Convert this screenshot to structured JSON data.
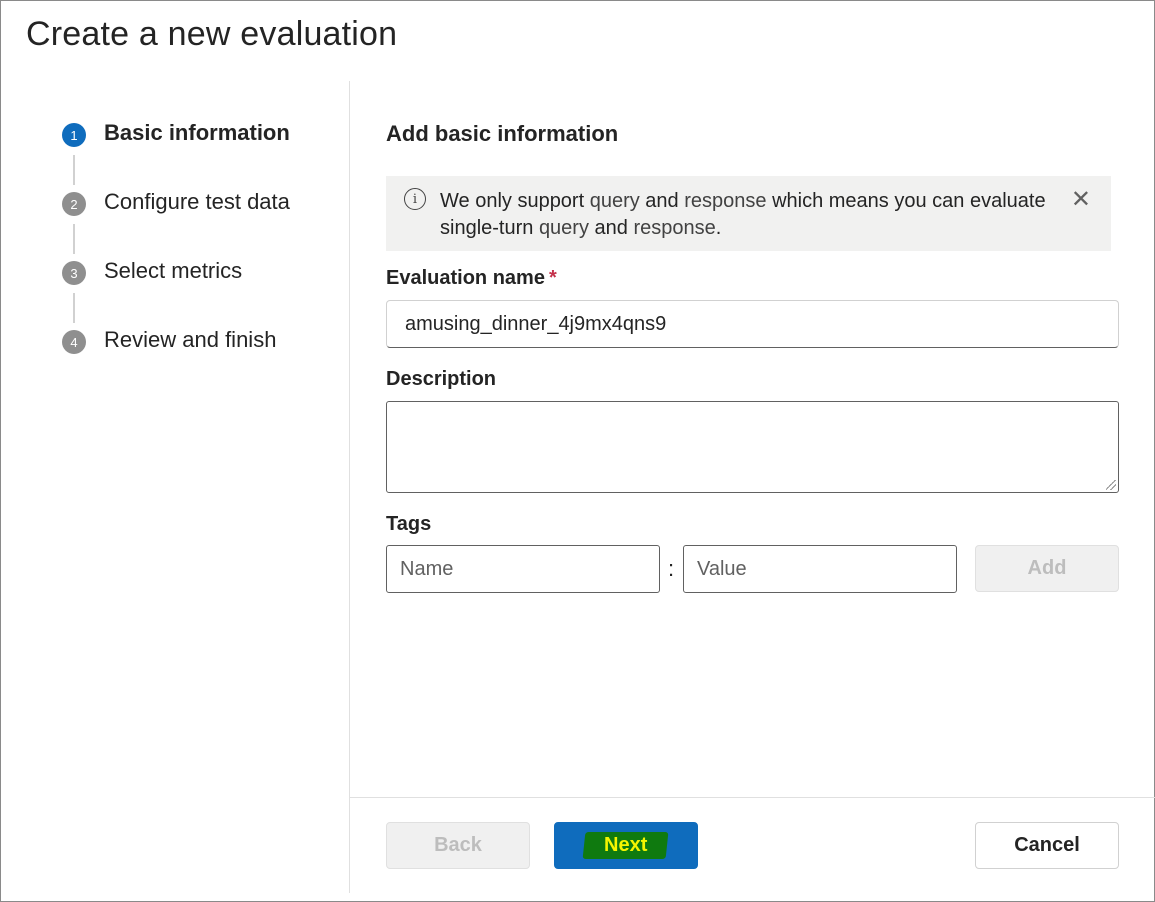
{
  "dialog": {
    "title": "Create a new evaluation"
  },
  "stepper": {
    "steps": [
      {
        "number": "1",
        "label": "Basic information",
        "active": true
      },
      {
        "number": "2",
        "label": "Configure test data",
        "active": false
      },
      {
        "number": "3",
        "label": "Select metrics",
        "active": false
      },
      {
        "number": "4",
        "label": "Review and finish",
        "active": false
      }
    ]
  },
  "form": {
    "section_title": "Add basic information",
    "info_bar": {
      "icon": "info-icon",
      "text_part1": "We only support ",
      "kw1": "query",
      "text_part2": " and ",
      "kw2": "response",
      "text_part3": " which means you can evaluate single-turn ",
      "kw3": "query",
      "text_part4": " and ",
      "kw4": "response",
      "text_part5": ".",
      "close_glyph": "✕"
    },
    "evaluation_name": {
      "label": "Evaluation name",
      "required_mark": "*",
      "value": "amusing_dinner_4j9mx4qns9"
    },
    "description": {
      "label": "Description",
      "value": ""
    },
    "tags": {
      "label": "Tags",
      "name_placeholder": "Name",
      "separator": ":",
      "value_placeholder": "Value",
      "add_label": "Add"
    }
  },
  "footer": {
    "back_label": "Back",
    "next_label": "Next",
    "cancel_label": "Cancel"
  },
  "colors": {
    "primary": "#0f6cbd",
    "required": "#c4314b",
    "highlight_bg": "#0f7a0f",
    "highlight_text": "#f5f500"
  }
}
